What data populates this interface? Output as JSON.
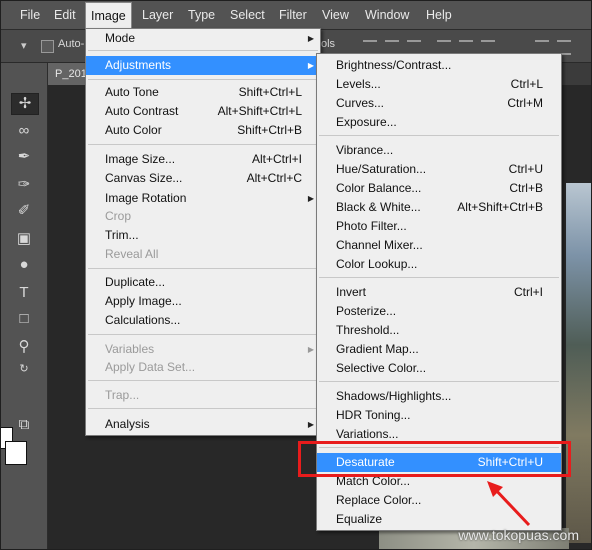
{
  "menubar": {
    "items": [
      "File",
      "Edit",
      "Image",
      "Layer",
      "Type",
      "Select",
      "Filter",
      "View",
      "Window",
      "Help"
    ],
    "active": "Image"
  },
  "options_bar": {
    "auto_label": "Auto-",
    "right_label": "ols"
  },
  "document": {
    "tab_label": "P_201"
  },
  "image_menu": {
    "mode": "Mode",
    "adjustments": "Adjustments",
    "auto_tone": "Auto Tone",
    "auto_tone_sc": "Shift+Ctrl+L",
    "auto_contrast": "Auto Contrast",
    "auto_contrast_sc": "Alt+Shift+Ctrl+L",
    "auto_color": "Auto Color",
    "auto_color_sc": "Shift+Ctrl+B",
    "image_size": "Image Size...",
    "image_size_sc": "Alt+Ctrl+I",
    "canvas_size": "Canvas Size...",
    "canvas_size_sc": "Alt+Ctrl+C",
    "image_rotation": "Image Rotation",
    "crop": "Crop",
    "trim": "Trim...",
    "reveal_all": "Reveal All",
    "duplicate": "Duplicate...",
    "apply_image": "Apply Image...",
    "calculations": "Calculations...",
    "variables": "Variables",
    "apply_data_set": "Apply Data Set...",
    "trap": "Trap...",
    "analysis": "Analysis"
  },
  "adjust_menu": {
    "brightness_contrast": "Brightness/Contrast...",
    "levels": "Levels...",
    "levels_sc": "Ctrl+L",
    "curves": "Curves...",
    "curves_sc": "Ctrl+M",
    "exposure": "Exposure...",
    "vibrance": "Vibrance...",
    "hue_saturation": "Hue/Saturation...",
    "hue_saturation_sc": "Ctrl+U",
    "color_balance": "Color Balance...",
    "color_balance_sc": "Ctrl+B",
    "black_white": "Black & White...",
    "black_white_sc": "Alt+Shift+Ctrl+B",
    "photo_filter": "Photo Filter...",
    "channel_mixer": "Channel Mixer...",
    "color_lookup": "Color Lookup...",
    "invert": "Invert",
    "invert_sc": "Ctrl+I",
    "posterize": "Posterize...",
    "threshold": "Threshold...",
    "gradient_map": "Gradient Map...",
    "selective_color": "Selective Color...",
    "shadows_highlights": "Shadows/Highlights...",
    "hdr_toning": "HDR Toning...",
    "variations": "Variations...",
    "desaturate": "Desaturate",
    "desaturate_sc": "Shift+Ctrl+U",
    "match_color": "Match Color...",
    "replace_color": "Replace Color...",
    "equalize": "Equalize"
  },
  "watermark": "www.tokopuas.com",
  "colors": {
    "highlight": "#3390ff",
    "annotation": "#e81c1c",
    "menu_bg": "#efefef"
  }
}
